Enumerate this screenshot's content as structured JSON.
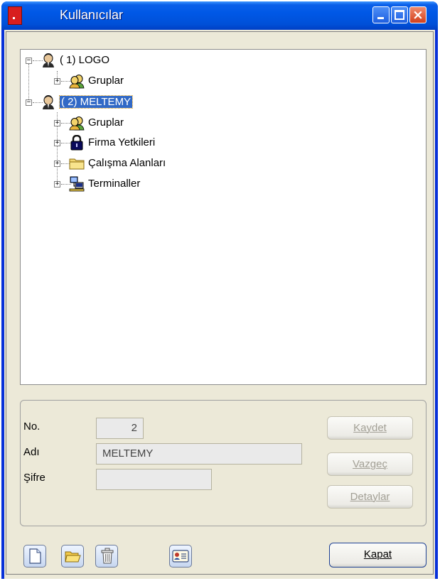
{
  "window": {
    "title": "Kullanıcılar"
  },
  "tree": {
    "nodes": [
      {
        "label": "( 1) LOGO"
      },
      {
        "label": "Gruplar"
      },
      {
        "label": "( 2) MELTEMY"
      },
      {
        "label": "Gruplar"
      },
      {
        "label": "Firma Yetkileri"
      },
      {
        "label": "Çalışma Alanları"
      },
      {
        "label": "Terminaller"
      }
    ],
    "expander_expanded": "−",
    "expander_collapsed": "+"
  },
  "form": {
    "no_label": "No.",
    "no_value": "2",
    "name_label": "Adı",
    "name_value": "MELTEMY",
    "password_label": "Şifre",
    "password_value": ""
  },
  "buttons": {
    "save": "Kaydet",
    "cancel": "Vazgeç",
    "details": "Detaylar",
    "close": "Kapat"
  },
  "icons": {
    "title_close": "×"
  },
  "colors": {
    "selection": "#3169c6",
    "titlebar": "#0058e6"
  }
}
